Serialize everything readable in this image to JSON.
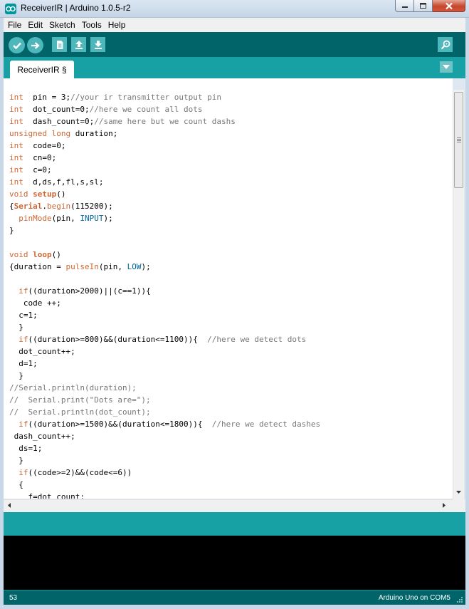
{
  "window": {
    "title": "ReceiverIR | Arduino 1.0.5-r2"
  },
  "menubar": {
    "items": [
      "File",
      "Edit",
      "Sketch",
      "Tools",
      "Help"
    ]
  },
  "toolbar": {
    "icons": [
      "verify-icon",
      "upload-icon",
      "new-icon",
      "open-icon",
      "save-icon",
      "serial-monitor-icon"
    ]
  },
  "tabs": [
    {
      "label": "ReceiverIR §"
    }
  ],
  "editor": {
    "lines": [
      [
        [
          "kw",
          "int"
        ],
        [
          "",
          "  pin = 3;"
        ],
        [
          "cm",
          "//your ir transmitter output pin"
        ]
      ],
      [
        [
          "kw",
          "int"
        ],
        [
          "",
          "  dot_count=0;"
        ],
        [
          "cm",
          "//here we count all dots"
        ]
      ],
      [
        [
          "kw",
          "int"
        ],
        [
          "",
          "  dash_count=0;"
        ],
        [
          "cm",
          "//same here but we count dashs"
        ]
      ],
      [
        [
          "kw",
          "unsigned"
        ],
        [
          "",
          " "
        ],
        [
          "kw",
          "long"
        ],
        [
          "",
          " duration;"
        ]
      ],
      [
        [
          "kw",
          "int"
        ],
        [
          "",
          "  code=0;"
        ]
      ],
      [
        [
          "kw",
          "int"
        ],
        [
          "",
          "  cn=0;"
        ]
      ],
      [
        [
          "kw",
          "int"
        ],
        [
          "",
          "  c=0;"
        ]
      ],
      [
        [
          "kw",
          "int"
        ],
        [
          "",
          "  d,ds,f,fl,s,sl;"
        ]
      ],
      [
        [
          "kw",
          "void"
        ],
        [
          "",
          " "
        ],
        [
          "kwb",
          "setup"
        ],
        [
          "",
          "()"
        ]
      ],
      [
        [
          "",
          "{"
        ],
        [
          "kwb",
          "Serial"
        ],
        [
          "",
          "."
        ],
        [
          "kw",
          "begin"
        ],
        [
          "",
          "(115200);"
        ]
      ],
      [
        [
          "",
          "  "
        ],
        [
          "kw",
          "pinMode"
        ],
        [
          "",
          "(pin, "
        ],
        [
          "const",
          "INPUT"
        ],
        [
          "",
          ");"
        ]
      ],
      [
        [
          "",
          "}"
        ]
      ],
      [
        [
          "",
          ""
        ]
      ],
      [
        [
          "kw",
          "void"
        ],
        [
          "",
          " "
        ],
        [
          "kwb",
          "loop"
        ],
        [
          "",
          "()"
        ]
      ],
      [
        [
          "",
          "{duration = "
        ],
        [
          "kw",
          "pulseIn"
        ],
        [
          "",
          "(pin, "
        ],
        [
          "const",
          "LOW"
        ],
        [
          "",
          ");"
        ]
      ],
      [
        [
          "",
          ""
        ]
      ],
      [
        [
          "",
          "  "
        ],
        [
          "kw",
          "if"
        ],
        [
          "",
          "((duration>2000)||(c==1)){"
        ]
      ],
      [
        [
          "",
          "   code ++;"
        ]
      ],
      [
        [
          "",
          "  c=1;"
        ]
      ],
      [
        [
          "",
          "  }"
        ]
      ],
      [
        [
          "",
          "  "
        ],
        [
          "kw",
          "if"
        ],
        [
          "",
          "((duration>=800)&&(duration<=1100)){  "
        ],
        [
          "cm",
          "//here we detect dots"
        ]
      ],
      [
        [
          "",
          "  dot_count++;"
        ]
      ],
      [
        [
          "",
          "  d=1;"
        ]
      ],
      [
        [
          "",
          "  }"
        ]
      ],
      [
        [
          "cm",
          "//Serial.println(duration);"
        ]
      ],
      [
        [
          "cm",
          "//  Serial.print(\"Dots are=\");"
        ]
      ],
      [
        [
          "cm",
          "//  Serial.println(dot_count);"
        ]
      ],
      [
        [
          "",
          "  "
        ],
        [
          "kw",
          "if"
        ],
        [
          "",
          "((duration>=1500)&&(duration<=1800)){  "
        ],
        [
          "cm",
          "//here we detect dashes"
        ]
      ],
      [
        [
          "",
          " dash_count++;"
        ]
      ],
      [
        [
          "",
          "  ds=1;"
        ]
      ],
      [
        [
          "",
          "  }"
        ]
      ],
      [
        [
          "",
          "  "
        ],
        [
          "kw",
          "if"
        ],
        [
          "",
          "((code>=2)&&(code<=6))"
        ]
      ],
      [
        [
          "",
          "  {"
        ]
      ],
      [
        [
          "",
          "    f=dot_count;"
        ]
      ]
    ]
  },
  "status": {
    "line_number": "53",
    "board": "Arduino Uno on COM5"
  },
  "colors": {
    "toolbar": "#006468",
    "tabbar": "#17a1a5",
    "keyword": "#cc6633",
    "constant": "#006699",
    "comment": "#777777"
  }
}
